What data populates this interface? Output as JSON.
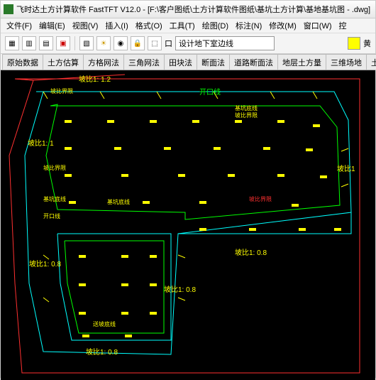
{
  "window": {
    "title": "飞时达土方计算软件 FastTFT V12.0 - [F:\\客户图纸\\土方计算软件图纸\\基坑土方计算\\基地基坑图 - .dwg]"
  },
  "menu": {
    "file": "文件(F)",
    "edit": "编辑(E)",
    "view": "视图(V)",
    "insert": "插入(I)",
    "format": "格式(O)",
    "tools": "工具(T)",
    "draw": "绘图(D)",
    "annotate": "标注(N)",
    "modify": "修改(M)",
    "window": "窗口(W)",
    "more": "控"
  },
  "toolbar": {
    "layer_checkbox_label": "",
    "layer_field": "设计地下室边线",
    "cmd_prefix": "口",
    "swatch_label": "黄"
  },
  "tabs": [
    {
      "label": "原始数据"
    },
    {
      "label": "土方估算"
    },
    {
      "label": "方格网法"
    },
    {
      "label": "三角网法"
    },
    {
      "label": "田块法"
    },
    {
      "label": "断面法"
    },
    {
      "label": "道路断面法"
    },
    {
      "label": "地层土方量"
    },
    {
      "label": "三维场地"
    },
    {
      "label": "土方调配"
    }
  ],
  "labels": {
    "a": "坡比1: 1.2",
    "b": "坡比界限",
    "c": "开口线",
    "d": "基坑底线",
    "e": "坡比界限",
    "f": "坡比1: 1",
    "g": "坡比界限",
    "h": "坡比1",
    "i": "坡比界限",
    "j": "基坑底线",
    "k": "基坑底线",
    "l": "开口线",
    "m": "坡比1: 0.8",
    "n": "坡比1: 0.8",
    "o": "坡比1: 0.8",
    "p": "坡比1: 0.8",
    "q": "送坡底线"
  },
  "colors": {
    "outer": "#ff3030",
    "mid": "#00ffff",
    "inner": "#00ff00",
    "text": "#ffff00"
  }
}
